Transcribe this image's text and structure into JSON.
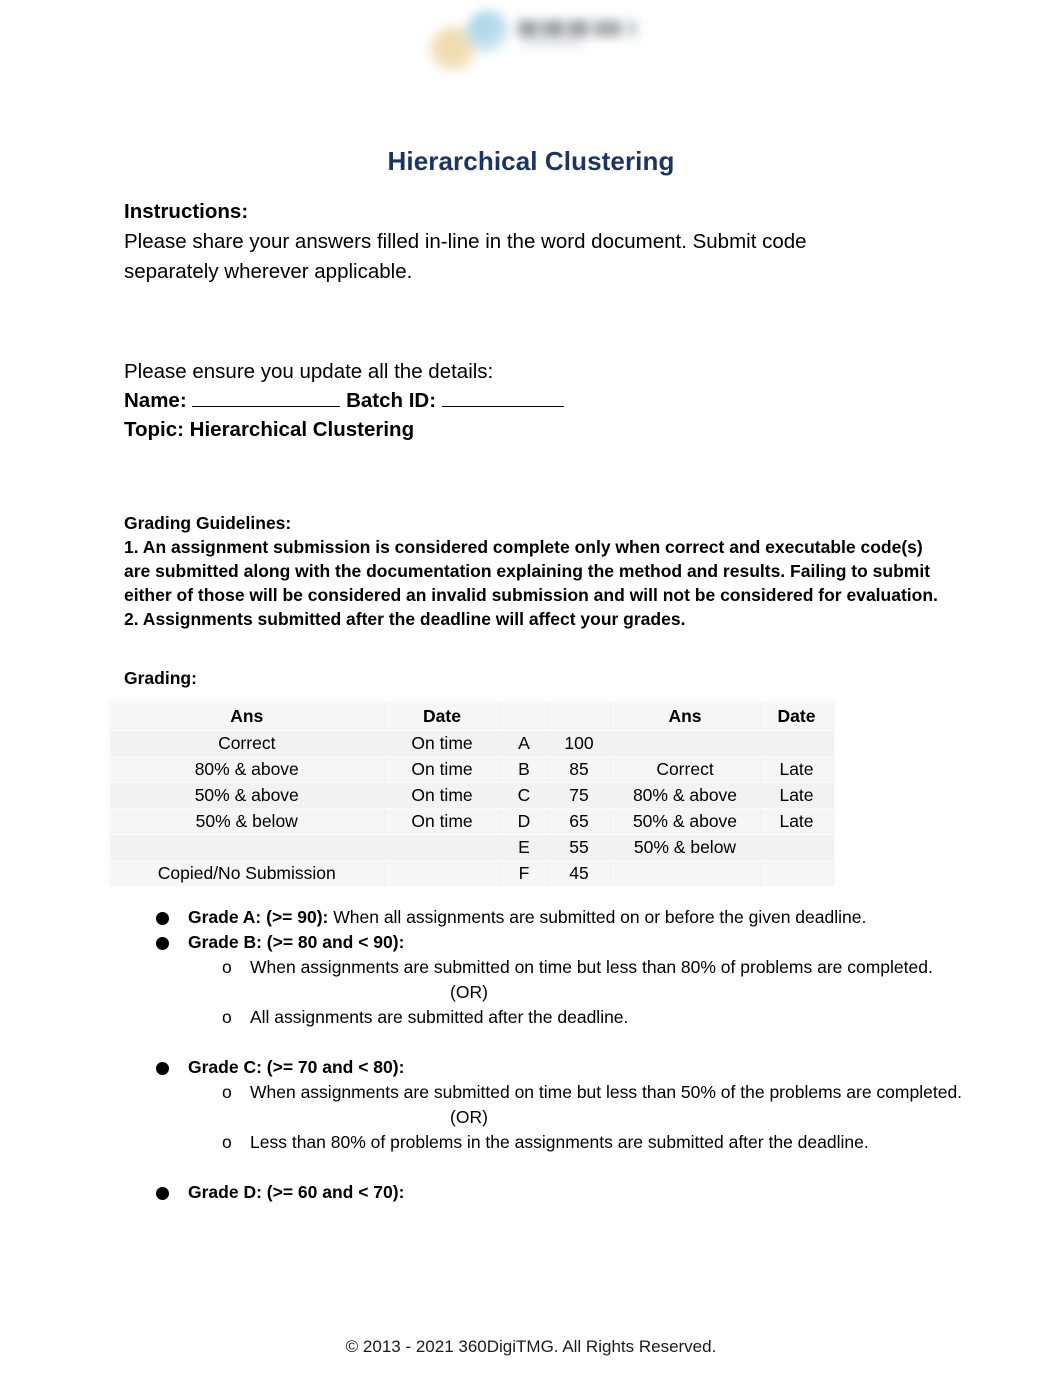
{
  "document": {
    "title": "Hierarchical Clustering",
    "title_color": "#1a3464",
    "logo_alt": "360DigiTMG logo"
  },
  "instructions": {
    "heading": "Instructions:",
    "body": "Please share your answers filled in-line in the word document. Submit code separately wherever applicable."
  },
  "details": {
    "ensure_line": "Please ensure you update all the details:",
    "name_label": "Name:",
    "batch_label": "Batch ID:",
    "name_value": "",
    "batch_value": "",
    "topic_line": "Topic: Hierarchical Clustering"
  },
  "grading_guidelines": {
    "heading": "Grading Guidelines:",
    "item1": "1. An assignment submission is considered complete only when correct and executable code(s) are submitted along with the documentation explaining the method and results. Failing to submit either of those will be considered an invalid submission and will not be considered for evaluation.",
    "item2": "2. Assignments submitted after the deadline will affect your grades."
  },
  "grading": {
    "label": "Grading:",
    "table": {
      "headers": [
        "Ans",
        "Date",
        "",
        "",
        "Ans",
        "Date"
      ],
      "rows": [
        [
          "Correct",
          "On time",
          "A",
          "100",
          "",
          ""
        ],
        [
          "80% & above",
          "On time",
          "B",
          "85",
          "Correct",
          "Late"
        ],
        [
          "50% & above",
          "On time",
          "C",
          "75",
          "80% & above",
          "Late"
        ],
        [
          "50% & below",
          "On time",
          "D",
          "65",
          "50% & above",
          "Late"
        ],
        [
          "",
          "",
          "E",
          "55",
          "50% & below",
          ""
        ],
        [
          "Copied/No Submission",
          "",
          "F",
          "45",
          "",
          ""
        ]
      ]
    }
  },
  "grade_descriptions": [
    {
      "head": "Grade A: (>= 90):",
      "inline": " When all assignments are submitted on or before the given deadline.",
      "subs": []
    },
    {
      "head": "Grade B: (>= 80 and < 90):",
      "inline": "",
      "subs": [
        "When assignments are submitted on time but less than 80% of problems are completed.",
        "(OR)",
        "All assignments are submitted after the deadline."
      ]
    },
    {
      "head": "Grade C: (>= 70 and < 80):",
      "inline": "",
      "subs": [
        "When assignments are submitted on time but less than 50% of the problems are completed.",
        "(OR)",
        "Less than 80% of problems in the assignments are submitted after the deadline."
      ]
    },
    {
      "head": "Grade D: (>= 60 and < 70):",
      "inline": "",
      "subs": []
    }
  ],
  "sub_marker": "o",
  "footer": {
    "text": "© 2013 - 2021 360DigiTMG. All Rights Reserved."
  }
}
